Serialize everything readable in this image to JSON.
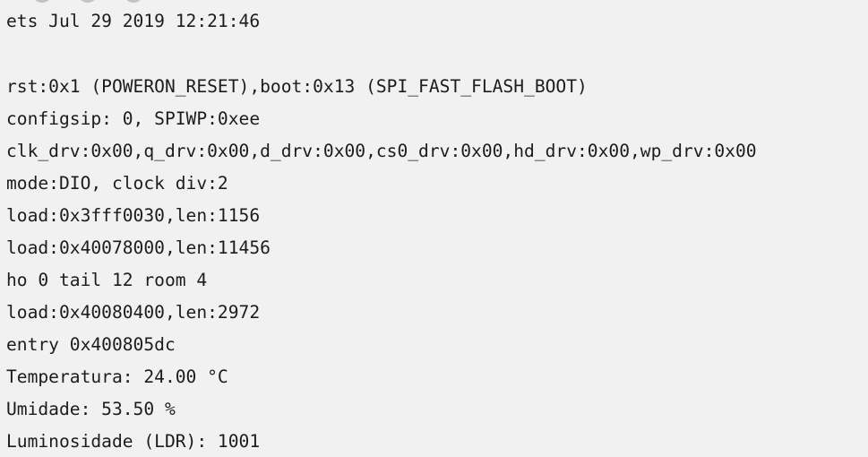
{
  "serial_monitor": {
    "lines": [
      "ets Jul 29 2019 12:21:46",
      "",
      "rst:0x1 (POWERON_RESET),boot:0x13 (SPI_FAST_FLASH_BOOT)",
      "configsip: 0, SPIWP:0xee",
      "clk_drv:0x00,q_drv:0x00,d_drv:0x00,cs0_drv:0x00,hd_drv:0x00,wp_drv:0x00",
      "mode:DIO, clock div:2",
      "load:0x3fff0030,len:1156",
      "load:0x40078000,len:11456",
      "ho 0 tail 12 room 4",
      "load:0x40080400,len:2972",
      "entry 0x400805dc",
      "Temperatura: 24.00 °C",
      "Umidade: 53.50 %",
      "Luminosidade (LDR): 1001"
    ]
  }
}
